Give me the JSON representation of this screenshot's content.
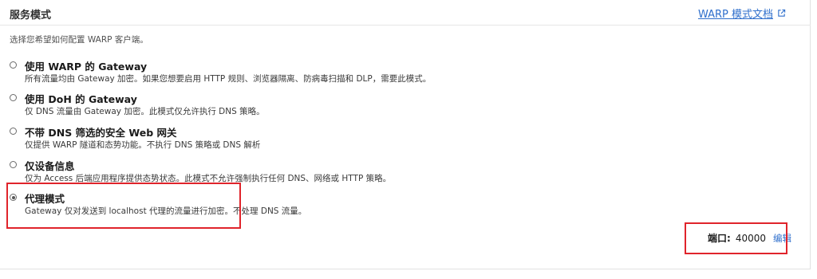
{
  "header": {
    "title": "服务模式",
    "doc_link_label": "WARP 模式文档"
  },
  "subtitle": "选择您希望如何配置 WARP 客户端。",
  "options": [
    {
      "label": "使用 WARP 的 Gateway",
      "description": "所有流量均由 Gateway 加密。如果您想要启用 HTTP 规则、浏览器隔离、防病毒扫描和 DLP，需要此模式。",
      "selected": false
    },
    {
      "label": "使用 DoH 的 Gateway",
      "description": "仅 DNS 流量由 Gateway 加密。此模式仅允许执行 DNS 策略。",
      "selected": false
    },
    {
      "label": "不带 DNS 筛选的安全 Web 网关",
      "description": "仅提供 WARP 隧道和态势功能。不执行 DNS 策略或 DNS 解析",
      "selected": false
    },
    {
      "label": "仅设备信息",
      "description": "仅为 Access 后端应用程序提供态势状态。此模式不允许强制执行任何 DNS、网络或 HTTP 策略。",
      "selected": false
    },
    {
      "label": "代理模式",
      "description": "Gateway 仅对发送到 localhost 代理的流量进行加密。不处理 DNS 流量。",
      "selected": true
    }
  ],
  "port": {
    "label": "端口:",
    "value": "40000",
    "edit_label": "编辑"
  },
  "colors": {
    "link": "#2f6fcc",
    "annotation": "#e0242b"
  }
}
